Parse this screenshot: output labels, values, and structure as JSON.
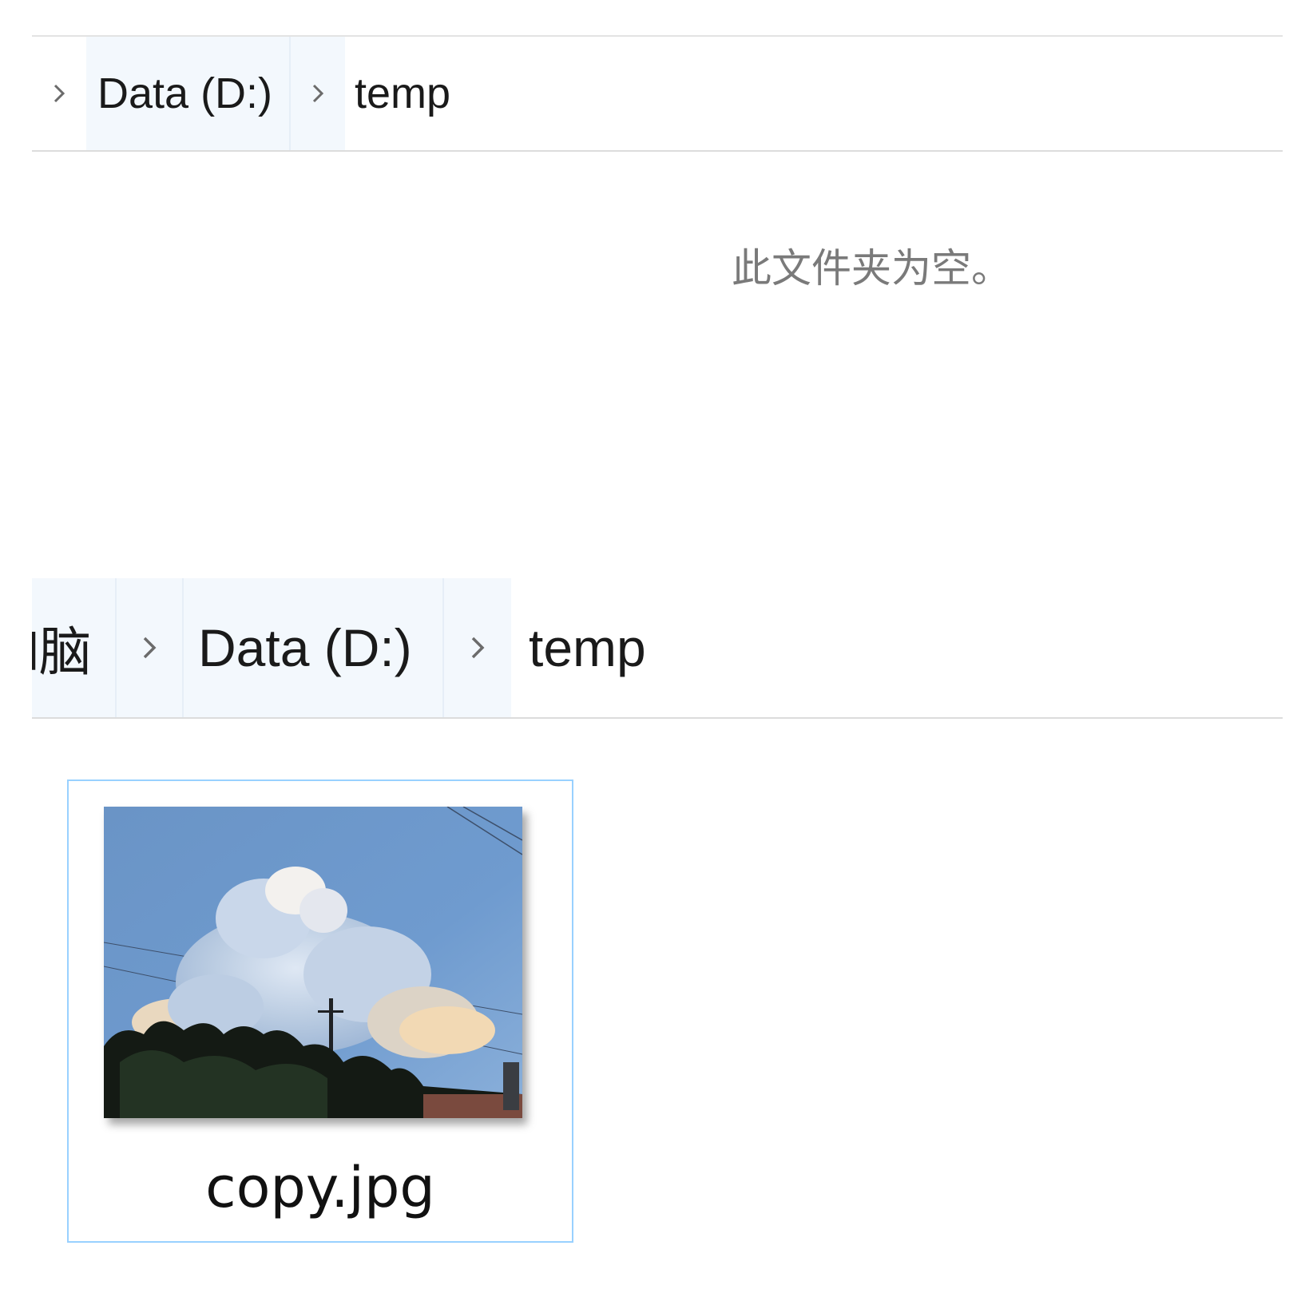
{
  "panel_empty": {
    "breadcrumb": {
      "items": [
        {
          "label": "Data (D:)"
        },
        {
          "label": "temp"
        }
      ]
    },
    "empty_message": "此文件夹为空。"
  },
  "panel_with_file": {
    "breadcrumb": {
      "items": [
        {
          "label": "l脑"
        },
        {
          "label": "Data (D:)"
        },
        {
          "label": "temp"
        }
      ]
    },
    "files": [
      {
        "name": "copy.jpg",
        "thumbnail": "sky-clouds-photo"
      }
    ]
  },
  "colors": {
    "selection_border": "#99d1ff",
    "crumb_hover_bg": "#f3f8fd",
    "empty_text": "#7a7a7a",
    "chevron": "#6b6b6b"
  },
  "icons": {
    "chevron": "chevron-right-icon"
  }
}
